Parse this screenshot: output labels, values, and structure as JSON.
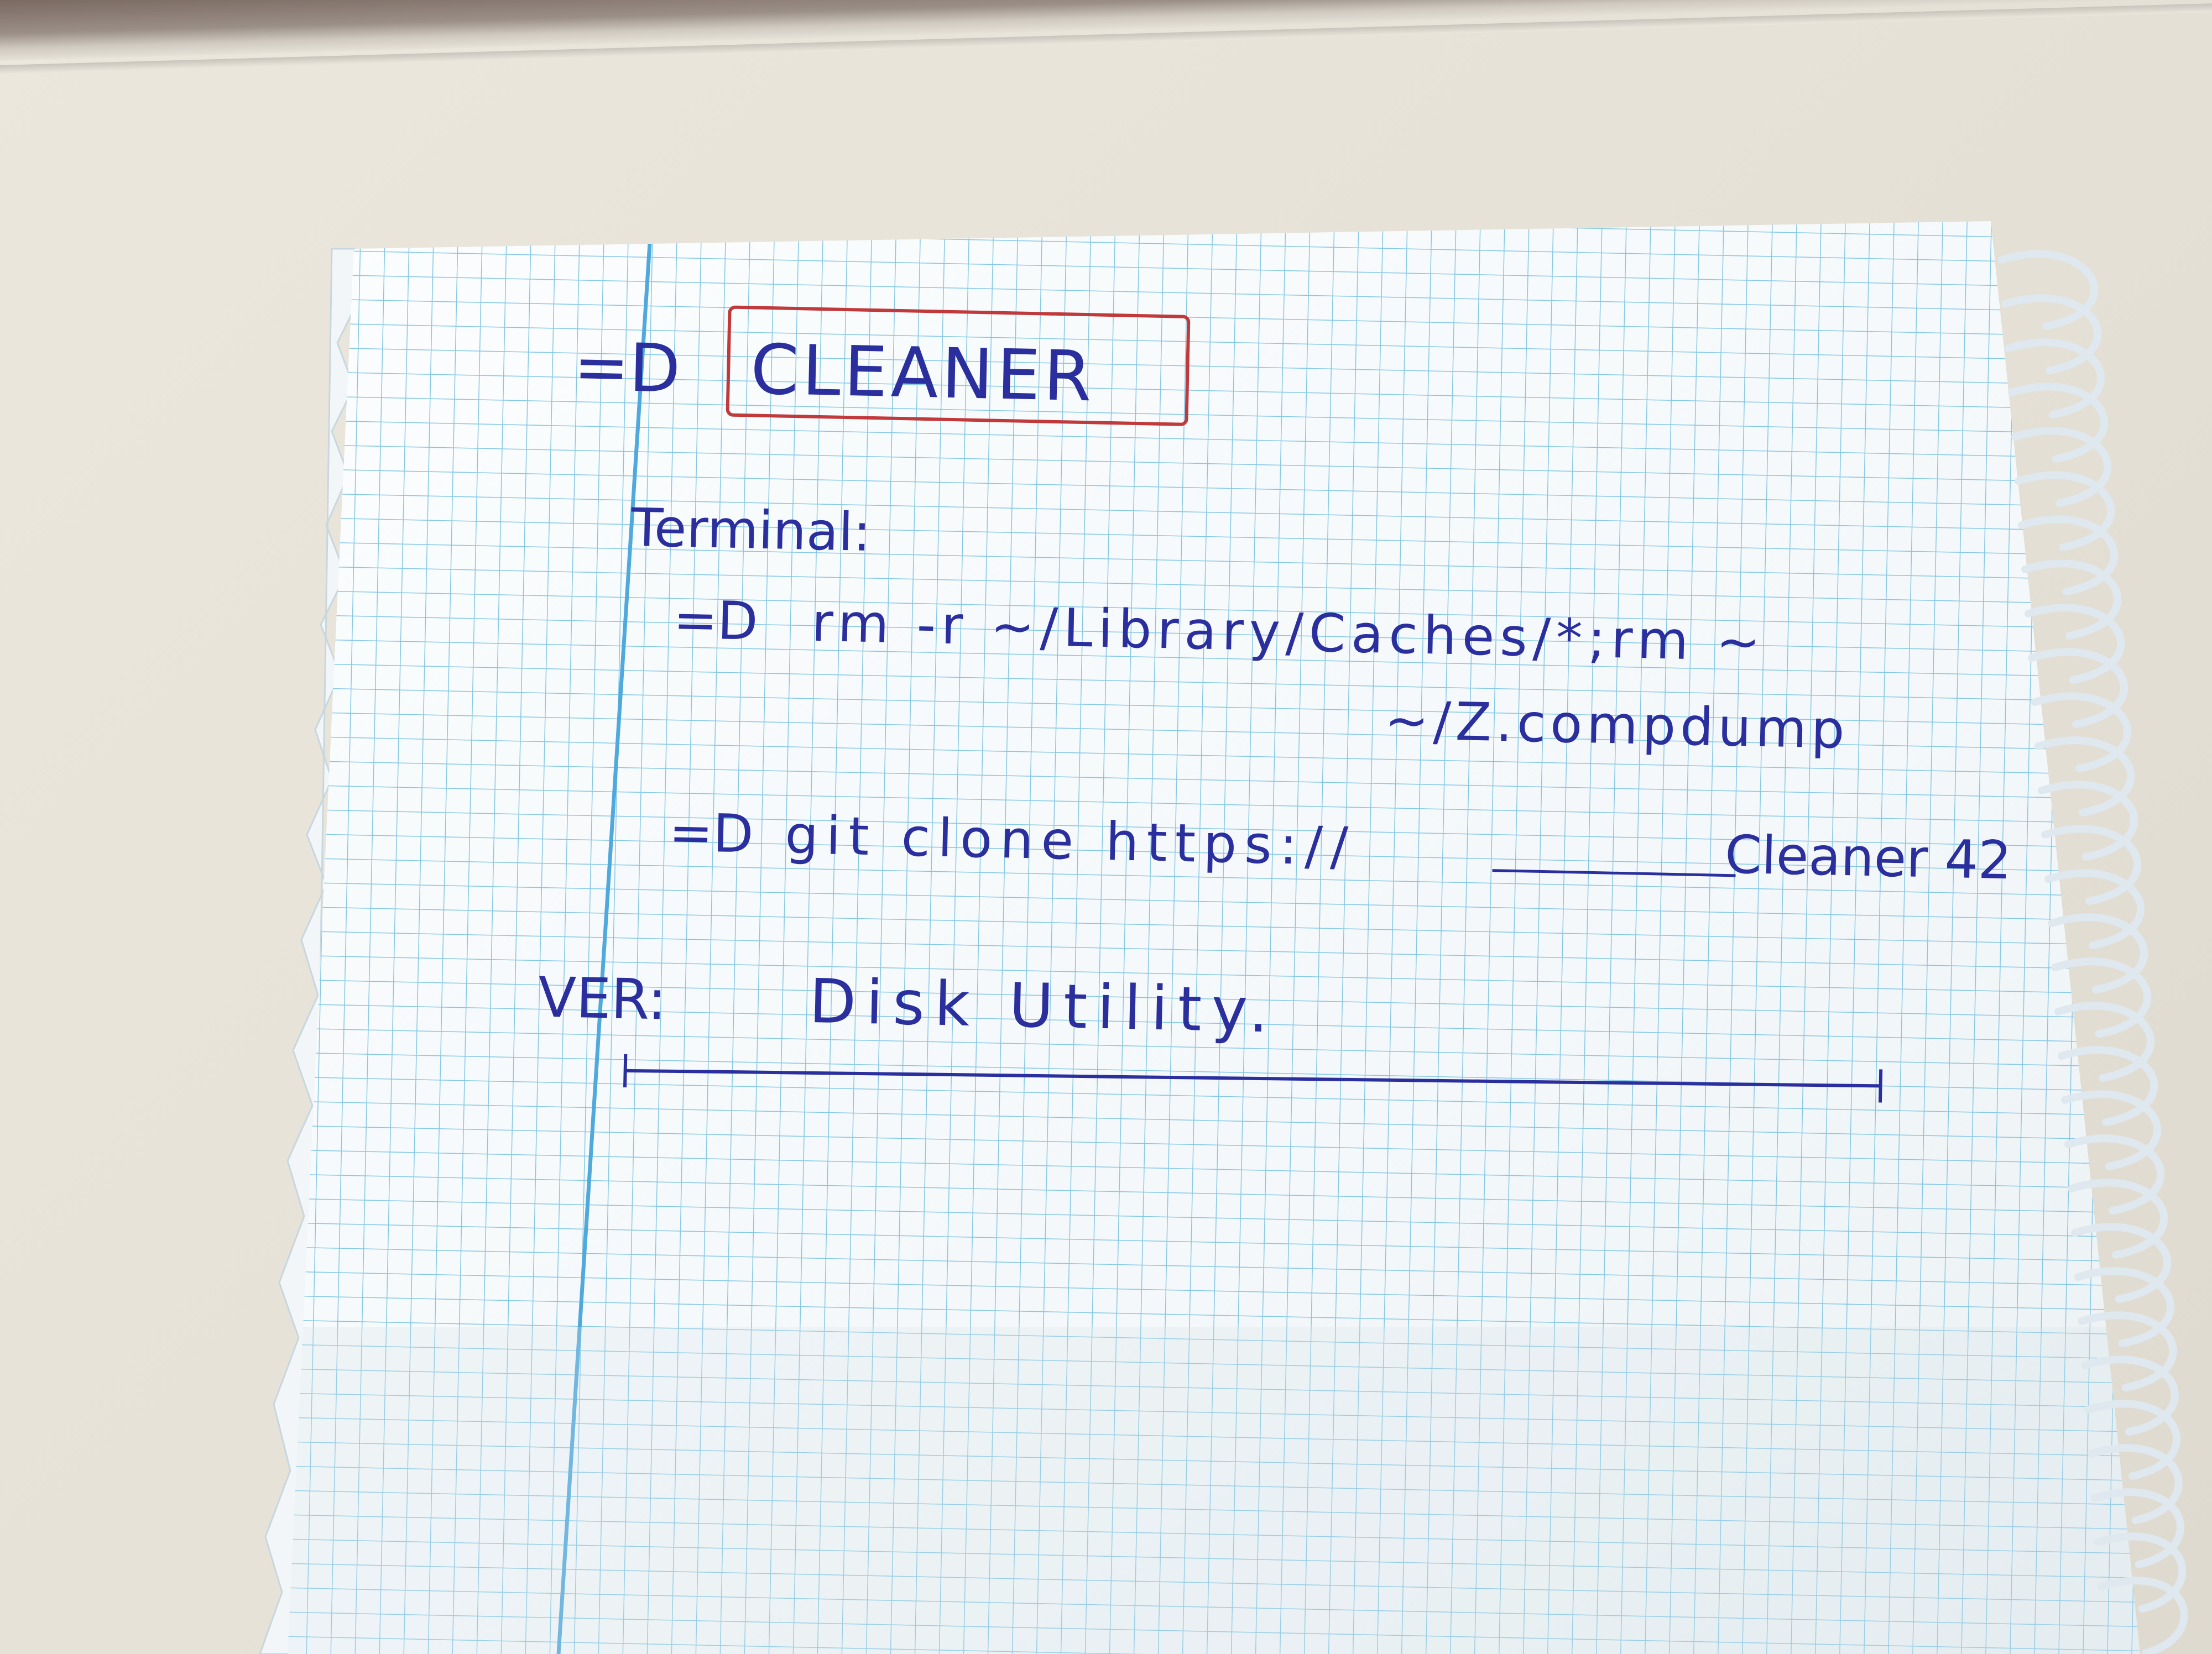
{
  "note": {
    "title_arrow": "=D",
    "title": "CLEANER",
    "section_label": "Terminal:",
    "line1_arrow": "=D",
    "line1_cmd": "rm -r ~/Library/Caches/*;rm ~",
    "line1_cont": "~/Z.compdump",
    "line2_arrow": "=D",
    "line2_cmd": "git clone https://",
    "line2_repo": "Cleaner 42",
    "footer_label": "VER:",
    "footer_text": "Disk Utility."
  },
  "colors": {
    "ink": "#2b2f9e",
    "box": "#c0393b",
    "grid": "#7fc6e3",
    "margin_line": "#55b0e0",
    "paper": "#f7fbfd",
    "spiral": "#d9e4ea"
  }
}
